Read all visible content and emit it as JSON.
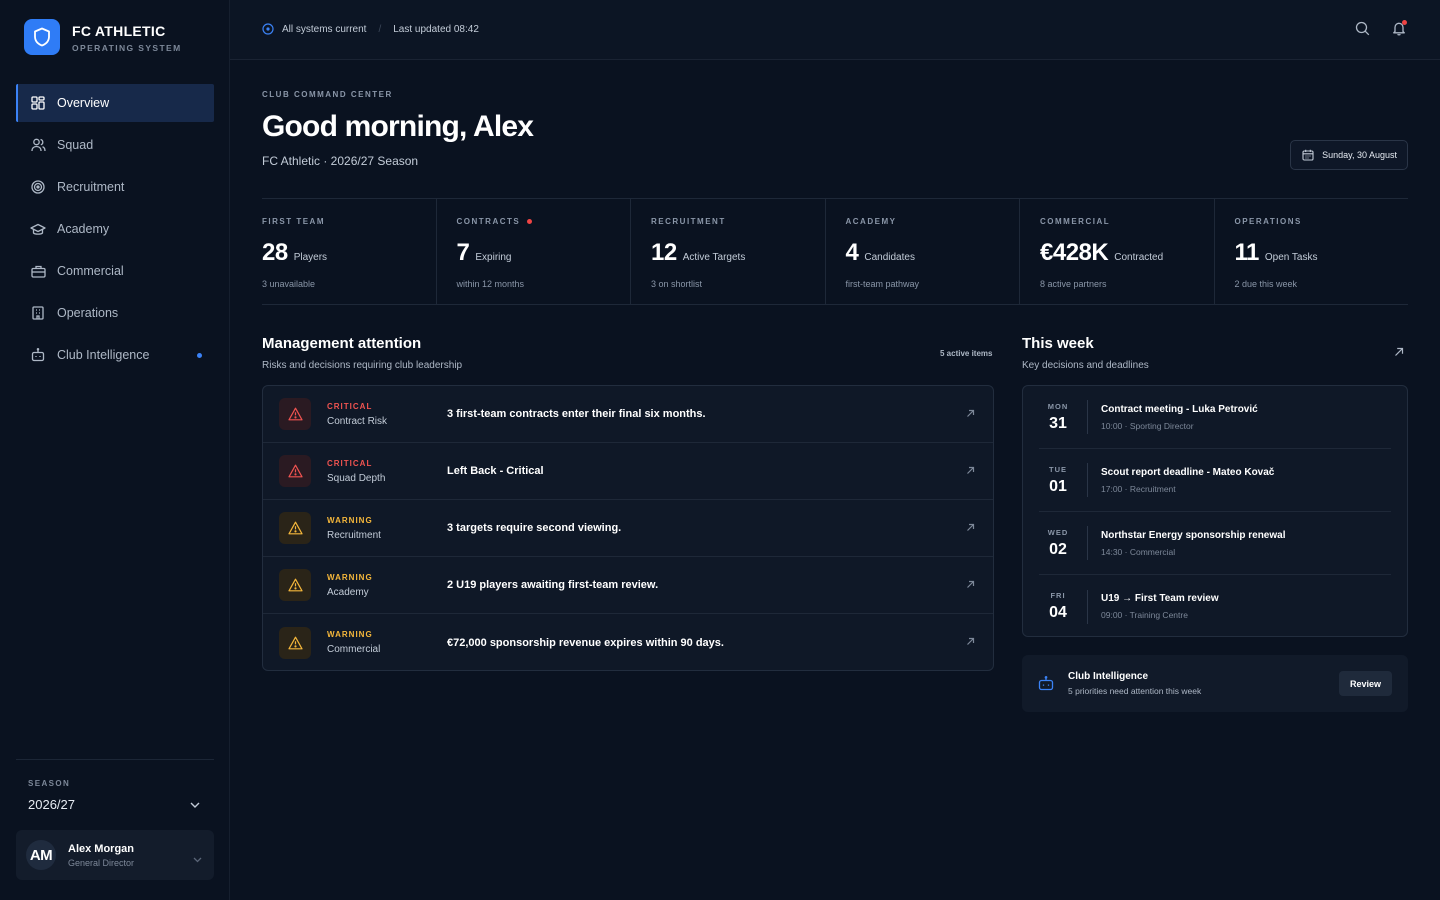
{
  "brand": {
    "name": "FC ATHLETIC",
    "subtitle": "OPERATING SYSTEM"
  },
  "nav": {
    "items": [
      {
        "label": "Overview",
        "icon": "grid-icon",
        "active": true
      },
      {
        "label": "Squad",
        "icon": "users-icon"
      },
      {
        "label": "Recruitment",
        "icon": "target-icon"
      },
      {
        "label": "Academy",
        "icon": "graduation-cap-icon"
      },
      {
        "label": "Commercial",
        "icon": "briefcase-icon"
      },
      {
        "label": "Operations",
        "icon": "building-icon"
      },
      {
        "label": "Club Intelligence",
        "icon": "bot-icon",
        "badge": true
      }
    ]
  },
  "season": {
    "label": "SEASON",
    "value": "2026/27"
  },
  "user": {
    "initials": "AM",
    "name": "Alex Morgan",
    "role": "General Director"
  },
  "topbar": {
    "status": "All systems current",
    "updated": "Last updated 08:42"
  },
  "header": {
    "eyebrow": "CLUB COMMAND CENTER",
    "greeting": "Good morning, Alex",
    "subtitle": "FC Athletic · 2026/27 Season",
    "date": "Sunday, 30 August"
  },
  "kpis": [
    {
      "label": "FIRST TEAM",
      "value": "28",
      "unit": "Players",
      "sub": "3 unavailable"
    },
    {
      "label": "CONTRACTS",
      "value": "7",
      "unit": "Expiring",
      "sub": "within 12 months",
      "alert": true
    },
    {
      "label": "RECRUITMENT",
      "value": "12",
      "unit": "Active Targets",
      "sub": "3 on shortlist"
    },
    {
      "label": "ACADEMY",
      "value": "4",
      "unit": "Candidates",
      "sub": "first-team pathway"
    },
    {
      "label": "COMMERCIAL",
      "value": "€428K",
      "unit": "Contracted",
      "sub": "8 active partners"
    },
    {
      "label": "OPERATIONS",
      "value": "11",
      "unit": "Open Tasks",
      "sub": "2 due this week"
    }
  ],
  "management": {
    "title": "Management attention",
    "subtitle": "Risks and decisions requiring club leadership",
    "count": "5 active items",
    "items": [
      {
        "level": "CRITICAL",
        "area": "Contract Risk",
        "text": "3 first-team contracts enter their final six months."
      },
      {
        "level": "CRITICAL",
        "area": "Squad Depth",
        "text": "Left Back - Critical"
      },
      {
        "level": "WARNING",
        "area": "Recruitment",
        "text": "3 targets require second viewing."
      },
      {
        "level": "WARNING",
        "area": "Academy",
        "text": "2 U19 players awaiting first-team review."
      },
      {
        "level": "WARNING",
        "area": "Commercial",
        "text": "€72,000 sponsorship revenue expires within 90 days."
      }
    ]
  },
  "week": {
    "title": "This week",
    "subtitle": "Key decisions and deadlines",
    "items": [
      {
        "dow": "MON",
        "day": "31",
        "event": "Contract meeting - Luka Petrović",
        "detail": "10:00 · Sporting Director"
      },
      {
        "dow": "TUE",
        "day": "01",
        "event": "Scout report deadline - Mateo Kovač",
        "detail": "17:00 · Recruitment"
      },
      {
        "dow": "WED",
        "day": "02",
        "event": "Northstar Energy sponsorship renewal",
        "detail": "14:30 · Commercial"
      },
      {
        "dow": "FRI",
        "day": "04",
        "event": "U19 → First Team review",
        "detail": "09:00 · Training Centre"
      }
    ]
  },
  "intelligence": {
    "title": "Club Intelligence",
    "subtitle": "5 priorities need attention this week",
    "button": "Review"
  },
  "colors": {
    "background": "#0a1220",
    "accent": "#3b82f6",
    "critical": "#ef5350",
    "warning": "#f5b73b"
  }
}
